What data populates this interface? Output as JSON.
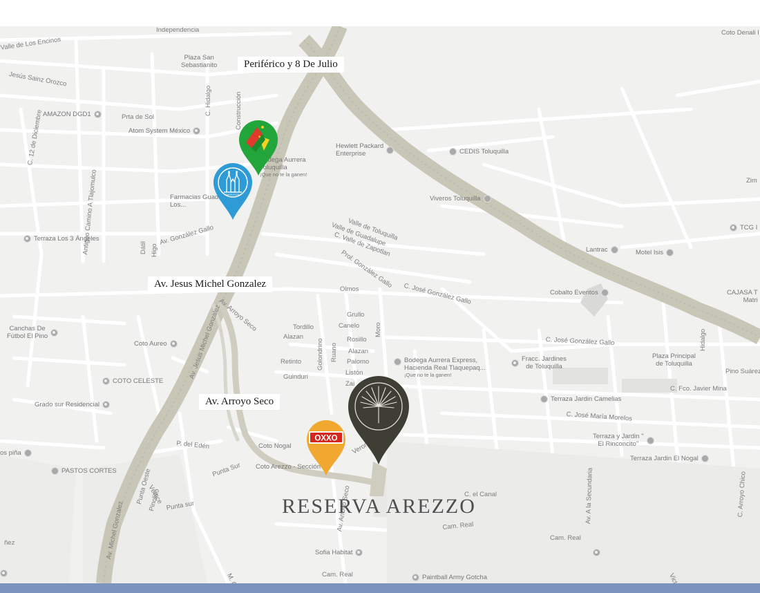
{
  "roads": [
    {
      "id": "periferico",
      "label": "Periférico y 8 De Julio"
    },
    {
      "id": "michel",
      "label": "Av. Jesus Michel Gonzalez"
    },
    {
      "id": "arroyo",
      "label": "Av. Arroyo Seco"
    }
  ],
  "title": "RESERVA AREZZO",
  "markers": {
    "green": {
      "icon": "bodega-aurrera-logo-icon",
      "color": "#22a53a"
    },
    "blue": {
      "icon": "church-logo-icon",
      "color": "#2e9bd6",
      "inner_text": "SANTA ELENA"
    },
    "oxxo": {
      "icon": "oxxo-logo-icon",
      "color": "#f0a830",
      "text": "OXXO"
    },
    "arezzo": {
      "icon": "palm-leaf-logo-icon",
      "color": "#3f3e35"
    }
  },
  "places": [
    {
      "name": "Plaza San\nSebastianito"
    },
    {
      "name": "AMAZON DGD1"
    },
    {
      "name": "Atom System México"
    },
    {
      "name": "Bodega Aurrera\nToluquilla",
      "sub": "¡Que no te la ganen!"
    },
    {
      "name": "Farmacias Guad...\nLos..."
    },
    {
      "name": "Terraza Los 3 Ángeles"
    },
    {
      "name": "Hewlett Packard\nEnterprise"
    },
    {
      "name": "CEDIS Toluquilla"
    },
    {
      "name": "Viveros Toluquilla"
    },
    {
      "name": "Coto Denali I"
    },
    {
      "name": "TCG I"
    },
    {
      "name": "Zim"
    },
    {
      "name": "Motel Isis"
    },
    {
      "name": "Cobalto Eventos"
    },
    {
      "name": "CAJASA T\nMatri"
    },
    {
      "name": "Canchas De\nFútbol El Pino"
    },
    {
      "name": "Coto Aureo"
    },
    {
      "name": "COTO CELESTE"
    },
    {
      "name": "Grado sur Residencial"
    },
    {
      "name": "PASTOS CORTES"
    },
    {
      "name": "Bodega Aurrera Express,\nHacienda Real Tlaquepaq...",
      "sub": "¡Que no te la ganen!"
    },
    {
      "name": "Fracc. Jardines\nde Toluquilla"
    },
    {
      "name": "Plaza Principal\nde Toluquilla"
    },
    {
      "name": "Terraza Jardin Camelias"
    },
    {
      "name": "Terraza y Jardin \"\nEl Rinconcito\""
    },
    {
      "name": "Terraza Jardin El Nogal"
    },
    {
      "name": "Coto Nogal"
    },
    {
      "name": "Coto Arezzo - Sección"
    },
    {
      "name": "Sofia Habitat"
    },
    {
      "name": "Paintball Army Gotcha"
    },
    {
      "name": "os piña"
    },
    {
      "name": "Lantrac"
    }
  ],
  "streets": [
    "Independencia",
    "Valle de Los Encinos",
    "Jesús Sainz Orozco",
    "Prta de Sol",
    "C. Hidalgo",
    "Construcción",
    "C. 12 de Diciembre",
    "Antiguo Camino A Tlajomulco",
    "Av. González Gallo",
    "Dátil",
    "Higo",
    "Valle de Toluquilla",
    "Valle de Guadalupe",
    "C. Valle de Zapotlan",
    "Prol. González Gallo",
    "Olmos",
    "C. José González Gallo",
    "Grullo",
    "Tordillo",
    "Canelo",
    "Moro",
    "Alazan",
    "Rosillo",
    "Retinto",
    "Alazan",
    "Palomo",
    "Golondrino",
    "Ruano",
    "Listón",
    "Guinduri",
    "Zai",
    "C. José González Gallo",
    "Hidalgo",
    "Pino Suárez",
    "C. Fco. Javier Mina",
    "C. José María Morelos",
    "P. del Edén",
    "Punta Sur",
    "Punta Oeste",
    "Pinolillo",
    "Vértice",
    "Punta sur",
    "Av. Michel Gonzalez",
    "Av. Jesus Michel Gonzalez",
    "Av. Arroyo Seco",
    "Verona",
    "C. el Canal",
    "Cam. Real",
    "Cam. Real",
    "Cam. Real",
    "Av. A la Secundaria",
    "C. Arroyo Chico",
    "Av. Arroyo Seco",
    "M. Quiroga",
    "Vict",
    "ñez"
  ]
}
